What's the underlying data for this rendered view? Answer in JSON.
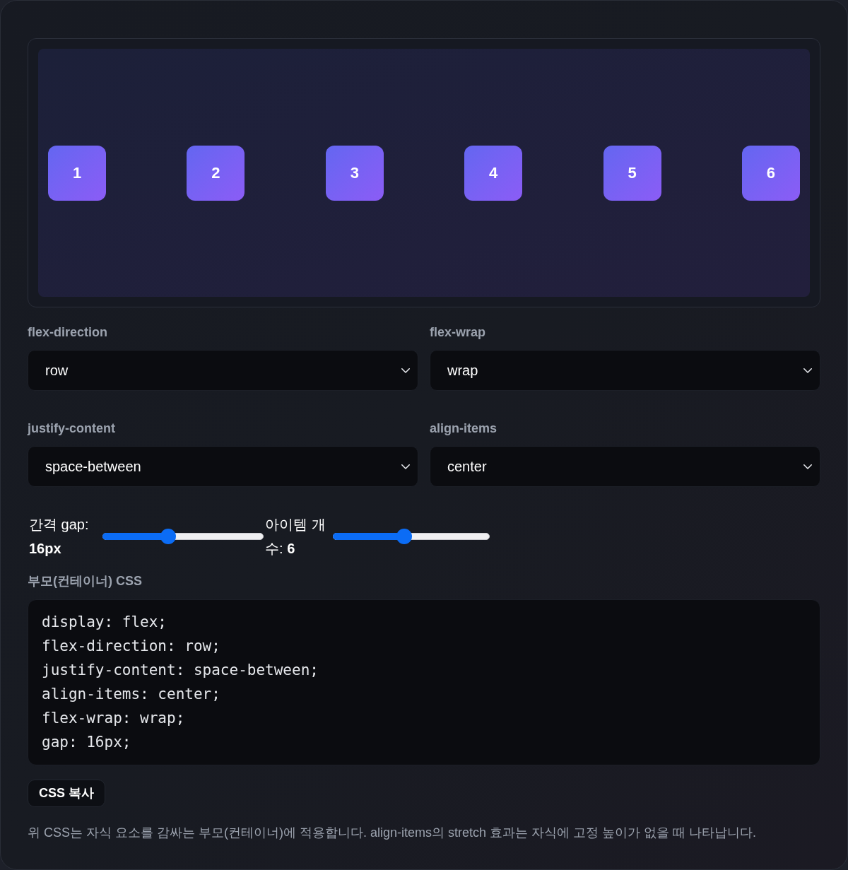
{
  "preview": {
    "items": [
      "1",
      "2",
      "3",
      "4",
      "5",
      "6"
    ]
  },
  "controls": [
    {
      "label": "flex-direction",
      "value": "row"
    },
    {
      "label": "flex-wrap",
      "value": "wrap"
    },
    {
      "label": "justify-content",
      "value": "space-between"
    },
    {
      "label": "align-items",
      "value": "center"
    }
  ],
  "sliders": [
    {
      "label": "간격 gap: **16px**",
      "level": 0.4
    },
    {
      "label": "아이템 개수: **6**",
      "level": 0.45
    }
  ],
  "css_section": {
    "title": "부모(컨테이너) CSS",
    "code": [
      "display: flex;",
      "flex-direction: row;",
      "justify-content: space-between;",
      "align-items: center;",
      "flex-wrap: wrap;",
      "gap: 16px;"
    ]
  },
  "copy_button": "CSS 복사",
  "note": "위 CSS는 자식 요소를 감싸는 부모(컨테이너)에 적용합니다. align-items의 stretch 효과는 자식에 고정 높이가 없을 때 나타납니다."
}
